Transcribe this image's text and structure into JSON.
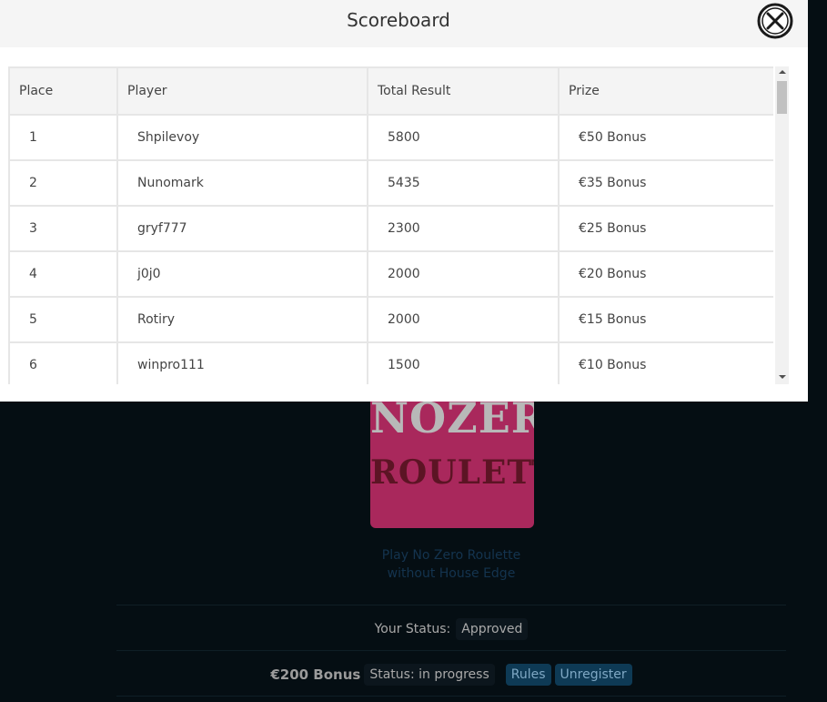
{
  "modal": {
    "title": "Scoreboard",
    "close_icon": "close-circle-icon"
  },
  "scoreboard": {
    "headers": {
      "place": "Place",
      "player": "Player",
      "total_result": "Total Result",
      "prize": "Prize"
    },
    "rows": [
      {
        "place": "1",
        "player": "Shpilevoy",
        "total_result": "5800",
        "prize": "€50 Bonus"
      },
      {
        "place": "2",
        "player": "Nunomark",
        "total_result": "5435",
        "prize": "€35 Bonus"
      },
      {
        "place": "3",
        "player": "gryf777",
        "total_result": "2300",
        "prize": "€25 Bonus"
      },
      {
        "place": "4",
        "player": "j0j0",
        "total_result": "2000",
        "prize": "€20 Bonus"
      },
      {
        "place": "5",
        "player": "Rotiry",
        "total_result": "2000",
        "prize": "€15 Bonus"
      },
      {
        "place": "6",
        "player": "winpro111",
        "total_result": "1500",
        "prize": "€10 Bonus"
      }
    ]
  },
  "background": {
    "game_logo": {
      "line1": "NOZER",
      "line1_mark": "0",
      "line2": "ROULETTE"
    },
    "game_caption_line1": "Play No Zero Roulette",
    "game_caption_line2": "without House Edge",
    "your_status_label": "Your Status:",
    "your_status_value": "Approved",
    "bonus_amount": "€200 Bonus",
    "bonus_status": "Status: in progress",
    "rules_button": "Rules",
    "unregister_button": "Unregister"
  },
  "colors": {
    "page_background": "#050e13",
    "game_tile": "#a9285c",
    "accent_button": "#0e3a55"
  }
}
